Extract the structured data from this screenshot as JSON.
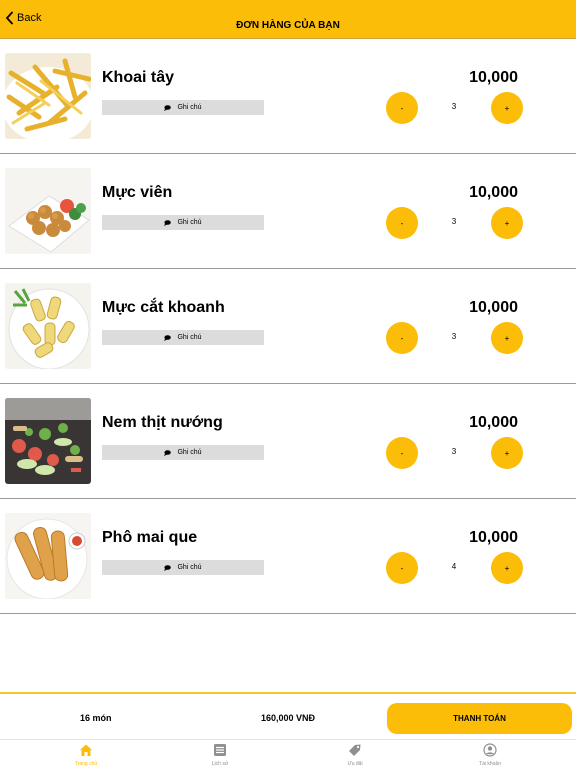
{
  "header": {
    "back_label": "Back",
    "title": "ĐƠN HÀNG CỦA BẠN"
  },
  "items": [
    {
      "name": "Khoai tây",
      "price": "10,000",
      "qty": "3",
      "note_label": "Ghi chú",
      "minus": "-",
      "plus": "+",
      "image": "french-fries"
    },
    {
      "name": "Mực viên",
      "price": "10,000",
      "qty": "3",
      "note_label": "Ghi chú",
      "minus": "-",
      "plus": "+",
      "image": "squid-balls"
    },
    {
      "name": "Mực cắt khoanh",
      "price": "10,000",
      "qty": "3",
      "note_label": "Ghi chú",
      "minus": "-",
      "plus": "+",
      "image": "squid-rings"
    },
    {
      "name": "Nem thịt nướng",
      "price": "10,000",
      "qty": "3",
      "note_label": "Ghi chú",
      "minus": "-",
      "plus": "+",
      "image": "grilled-pork-rolls"
    },
    {
      "name": "Phô mai que",
      "price": "10,000",
      "qty": "4",
      "note_label": "Ghi chú",
      "minus": "-",
      "plus": "+",
      "image": "cheese-sticks"
    }
  ],
  "footer": {
    "count": "16 món",
    "total": "160,000 VNĐ",
    "pay_label": "THANH TOÁN"
  },
  "tabs": [
    {
      "label": "Trang chủ",
      "icon": "home-icon",
      "active": true
    },
    {
      "label": "Lịch sử",
      "icon": "list-icon",
      "active": false
    },
    {
      "label": "Ưu đãi",
      "icon": "tag-icon",
      "active": false
    },
    {
      "label": "Tài khoản",
      "icon": "account-icon",
      "active": false
    }
  ],
  "colors": {
    "accent": "#fbbd08",
    "divider": "#9a9a9a",
    "note_bg": "#dcdcdc",
    "tab_inactive": "#8e8e93"
  }
}
